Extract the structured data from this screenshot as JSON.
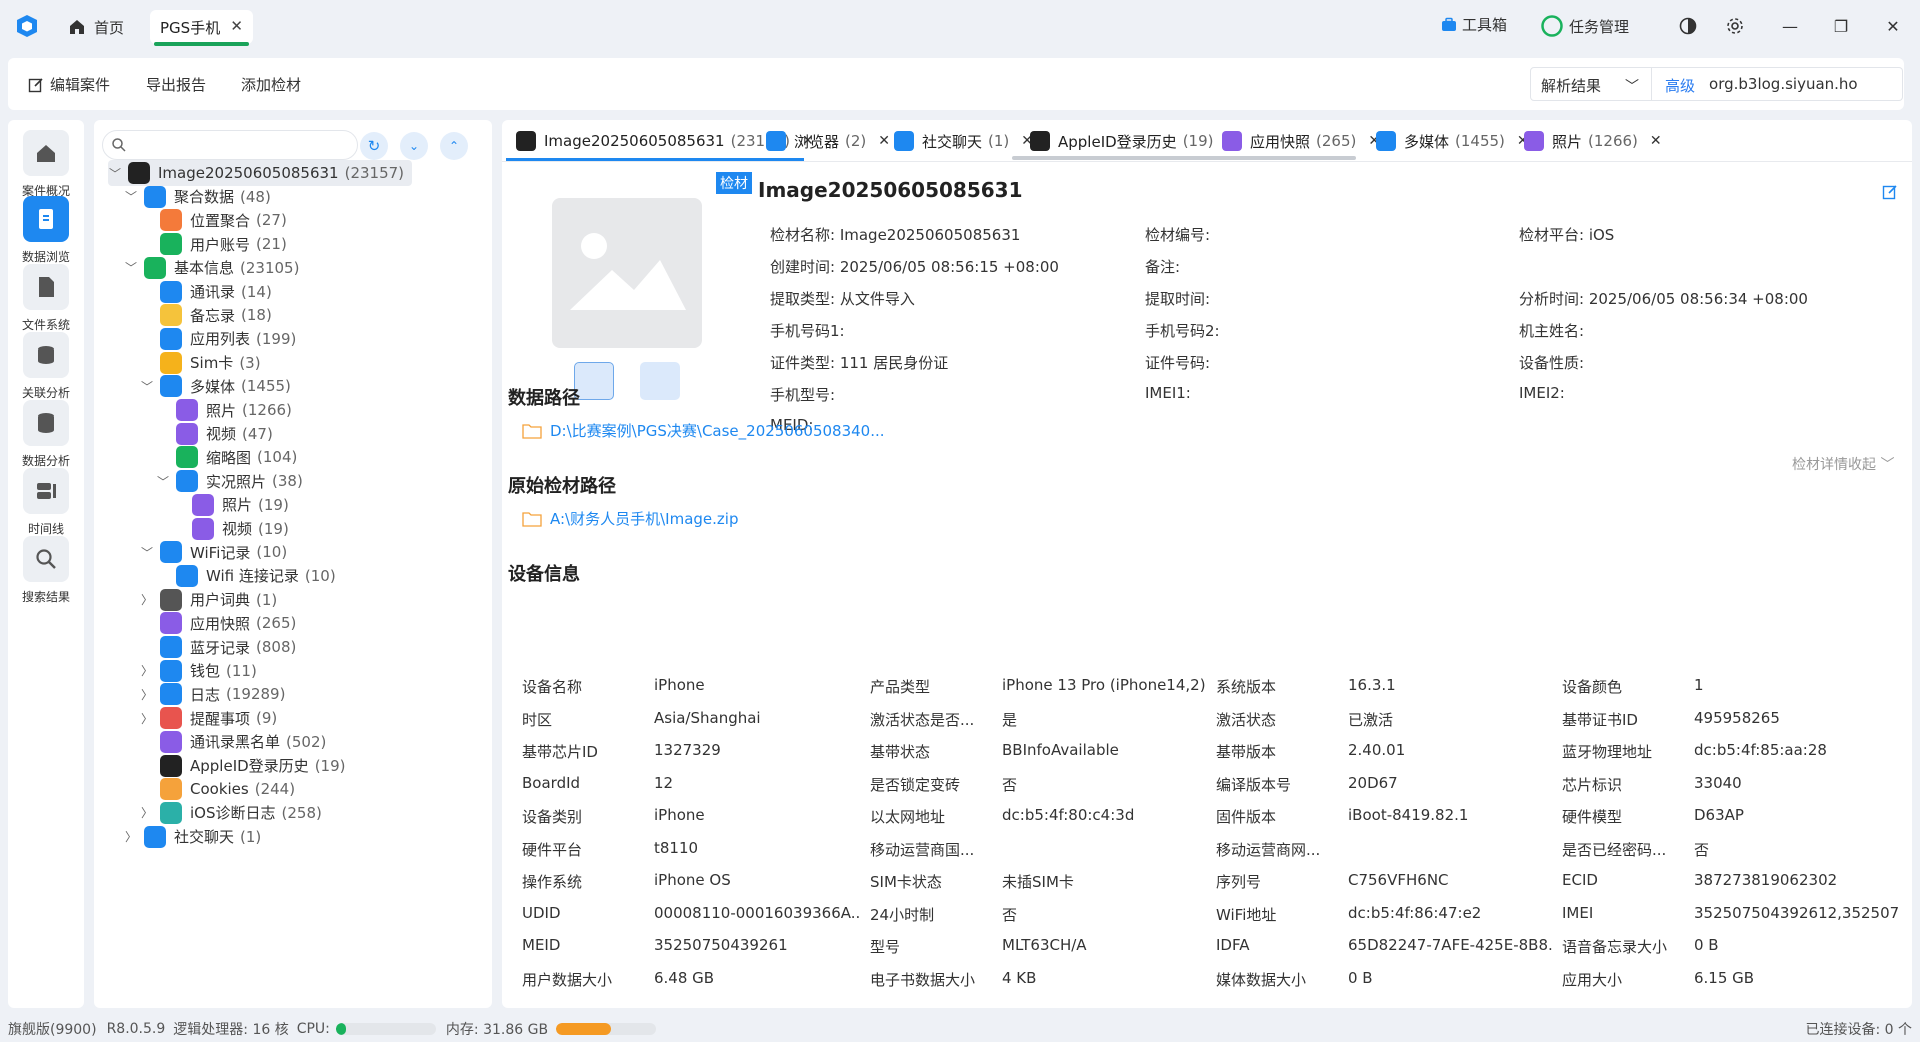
{
  "titlebar": {
    "home_label": "首页",
    "active_tab_label": "PGS手机",
    "toolbox_label": "工具箱",
    "task_label": "任务管理"
  },
  "toolbar": {
    "edit_case": "编辑案件",
    "export_report": "导出报告",
    "add_evidence": "添加检材",
    "select_value": "解析结果",
    "search_advanced": "高级",
    "search_value": "org.b3log.siyuan.ho"
  },
  "leftnav": [
    {
      "label": "案件概况",
      "icon": "home-icon"
    },
    {
      "label": "数据浏览",
      "icon": "data-browse-icon"
    },
    {
      "label": "文件系统",
      "icon": "file-system-icon"
    },
    {
      "label": "关联分析",
      "icon": "correlation-icon"
    },
    {
      "label": "数据分析",
      "icon": "database-icon"
    },
    {
      "label": "时间线",
      "icon": "timeline-icon"
    },
    {
      "label": "搜索结果",
      "icon": "search-icon"
    }
  ],
  "tree": [
    {
      "label": "Image20250605085631",
      "count": "(23157)",
      "level": 0,
      "arrow": "down",
      "color": "#222222",
      "selected": true
    },
    {
      "label": "聚合数据",
      "count": "(48)",
      "level": 1,
      "arrow": "down",
      "color": "#1e88f0"
    },
    {
      "label": "位置聚合",
      "count": "(27)",
      "level": 2,
      "arrow": "",
      "color": "#f47a3a"
    },
    {
      "label": "用户账号",
      "count": "(21)",
      "level": 2,
      "arrow": "",
      "color": "#19b25c"
    },
    {
      "label": "基本信息",
      "count": "(23105)",
      "level": 1,
      "arrow": "down",
      "color": "#19b25c"
    },
    {
      "label": "通讯录",
      "count": "(14)",
      "level": 2,
      "arrow": "",
      "color": "#1e88f0"
    },
    {
      "label": "备忘录",
      "count": "(18)",
      "level": 2,
      "arrow": "",
      "color": "#f5c33b"
    },
    {
      "label": "应用列表",
      "count": "(199)",
      "level": 2,
      "arrow": "",
      "color": "#1e88f0"
    },
    {
      "label": "Sim卡",
      "count": "(3)",
      "level": 2,
      "arrow": "",
      "color": "#f5b21b"
    },
    {
      "label": "多媒体",
      "count": "(1455)",
      "level": 2,
      "arrow": "down",
      "color": "#1e88f0"
    },
    {
      "label": "照片",
      "count": "(1266)",
      "level": 3,
      "arrow": "",
      "color": "#8a5ce6"
    },
    {
      "label": "视频",
      "count": "(47)",
      "level": 3,
      "arrow": "",
      "color": "#8a5ce6"
    },
    {
      "label": "缩略图",
      "count": "(104)",
      "level": 3,
      "arrow": "",
      "color": "#19b25c"
    },
    {
      "label": "实况照片",
      "count": "(38)",
      "level": 3,
      "arrow": "down",
      "color": "#1e88f0"
    },
    {
      "label": "照片",
      "count": "(19)",
      "level": 4,
      "arrow": "",
      "color": "#8a5ce6"
    },
    {
      "label": "视频",
      "count": "(19)",
      "level": 4,
      "arrow": "",
      "color": "#8a5ce6"
    },
    {
      "label": "WiFi记录",
      "count": "(10)",
      "level": 2,
      "arrow": "down",
      "color": "#1e88f0"
    },
    {
      "label": "Wifi 连接记录",
      "count": "(10)",
      "level": 3,
      "arrow": "",
      "color": "#1e88f0"
    },
    {
      "label": "用户词典",
      "count": "(1)",
      "level": 2,
      "arrow": "right",
      "color": "#555555"
    },
    {
      "label": "应用快照",
      "count": "(265)",
      "level": 2,
      "arrow": "",
      "color": "#8a5ce6"
    },
    {
      "label": "蓝牙记录",
      "count": "(808)",
      "level": 2,
      "arrow": "",
      "color": "#1e88f0"
    },
    {
      "label": "钱包",
      "count": "(11)",
      "level": 2,
      "arrow": "right",
      "color": "#1e88f0"
    },
    {
      "label": "日志",
      "count": "(19289)",
      "level": 2,
      "arrow": "right",
      "color": "#1e88f0"
    },
    {
      "label": "提醒事项",
      "count": "(9)",
      "level": 2,
      "arrow": "right",
      "color": "#e8544e"
    },
    {
      "label": "通讯录黑名单",
      "count": "(502)",
      "level": 2,
      "arrow": "",
      "color": "#8a5ce6"
    },
    {
      "label": "AppleID登录历史",
      "count": "(19)",
      "level": 2,
      "arrow": "",
      "color": "#222222"
    },
    {
      "label": "Cookies",
      "count": "(244)",
      "level": 2,
      "arrow": "",
      "color": "#f5a23b"
    },
    {
      "label": "iOS诊断日志",
      "count": "(258)",
      "level": 2,
      "arrow": "right",
      "color": "#2bb0a8"
    },
    {
      "label": "社交聊天",
      "count": "(1)",
      "level": 1,
      "arrow": "right",
      "color": "#1e88f0"
    }
  ],
  "tabs": [
    {
      "label": "Image20250605085631",
      "count": "(23157)",
      "color": "#222222"
    },
    {
      "label": "浏览器",
      "count": "(2)",
      "color": "#1e88f0"
    },
    {
      "label": "社交聊天",
      "count": "(1)",
      "color": "#1e88f0"
    },
    {
      "label": "AppleID登录历史",
      "count": "(19)",
      "color": "#222222"
    },
    {
      "label": "应用快照",
      "count": "(265)",
      "color": "#8a5ce6"
    },
    {
      "label": "多媒体",
      "count": "(1455)",
      "color": "#1e88f0"
    },
    {
      "label": "照片",
      "count": "(1266)",
      "color": "#8a5ce6"
    }
  ],
  "detail": {
    "badge": "检材",
    "title": "Image20250605085631",
    "collapse_label": "检材详情收起",
    "fields": [
      "检材名称: Image20250605085631",
      "检材编号:",
      "检材平台: iOS",
      "创建时间: 2025/06/05 08:56:15 +08:00",
      "备注:",
      "",
      "提取类型: 从文件导入",
      "提取时间:",
      "分析时间: 2025/06/05 08:56:34 +08:00",
      "手机号码1:",
      "手机号码2:",
      "机主姓名:",
      "证件类型: 111 居民身份证",
      "证件号码:",
      "设备性质:",
      "手机型号:",
      "IMEI1:",
      "IMEI2:",
      "MEID:",
      "",
      ""
    ]
  },
  "data_path": {
    "title": "数据路径",
    "value": "D:\\比赛案例\\PGS决赛\\Case_2025060508340..."
  },
  "source_path": {
    "title": "原始检材路径",
    "value": "A:\\财务人员手机\\Image.zip"
  },
  "device_info": {
    "title": "设备信息",
    "rows": [
      [
        "设备名称",
        "iPhone",
        "产品类型",
        "iPhone 13 Pro (iPhone14,2)",
        "系统版本",
        "16.3.1",
        "设备颜色",
        "1"
      ],
      [
        "时区",
        "Asia/Shanghai",
        "激活状态是否...",
        "是",
        "激活状态",
        "已激活",
        "基带证书ID",
        "495958265"
      ],
      [
        "基带芯片ID",
        "1327329",
        "基带状态",
        "BBInfoAvailable",
        "基带版本",
        "2.40.01",
        "蓝牙物理地址",
        "dc:b5:4f:85:aa:28"
      ],
      [
        "BoardId",
        "12",
        "是否锁定变砖",
        "否",
        "编译版本号",
        "20D67",
        "芯片标识",
        "33040"
      ],
      [
        "设备类别",
        "iPhone",
        "以太网地址",
        "dc:b5:4f:80:c4:3d",
        "固件版本",
        "iBoot-8419.82.1",
        "硬件模型",
        "D63AP"
      ],
      [
        "硬件平台",
        "t8110",
        "移动运营商国...",
        "",
        "移动运营商网...",
        "",
        "是否已经密码...",
        "否"
      ],
      [
        "操作系统",
        "iPhone OS",
        "SIM卡状态",
        "未插SIM卡",
        "序列号",
        "C756VFH6NC",
        "ECID",
        "387273819062302"
      ],
      [
        "UDID",
        "00008110-00016039366A...",
        "24小时制",
        "否",
        "WiFi地址",
        "dc:b5:4f:86:47:e2",
        "IMEI",
        "352507504392612,352507..."
      ],
      [
        "MEID",
        "35250750439261",
        "型号",
        "MLT63CH/A",
        "IDFA",
        "65D82247-7AFE-425E-8B8...",
        "语音备忘录大小",
        "0 B"
      ],
      [
        "用户数据大小",
        "6.48 GB",
        "电子书数据大小",
        "4 KB",
        "媒体数据大小",
        "0 B",
        "应用大小",
        "6.15 GB"
      ]
    ]
  },
  "status": {
    "edition": "旗舰版(9900)",
    "version": "R8.0.5.9",
    "cpu_cores": "逻辑处理器: 16 核",
    "cpu_label": "CPU:",
    "cpu_usage": 0.1,
    "mem_label": "内存: 31.86 GB",
    "mem_usage": 0.55,
    "connected": "已连接设备: 0 个"
  },
  "colors": {
    "accent": "#1e88f0",
    "tab_green": "#1aa35a",
    "cpu": "#19b25c",
    "mem": "#f59a23"
  }
}
